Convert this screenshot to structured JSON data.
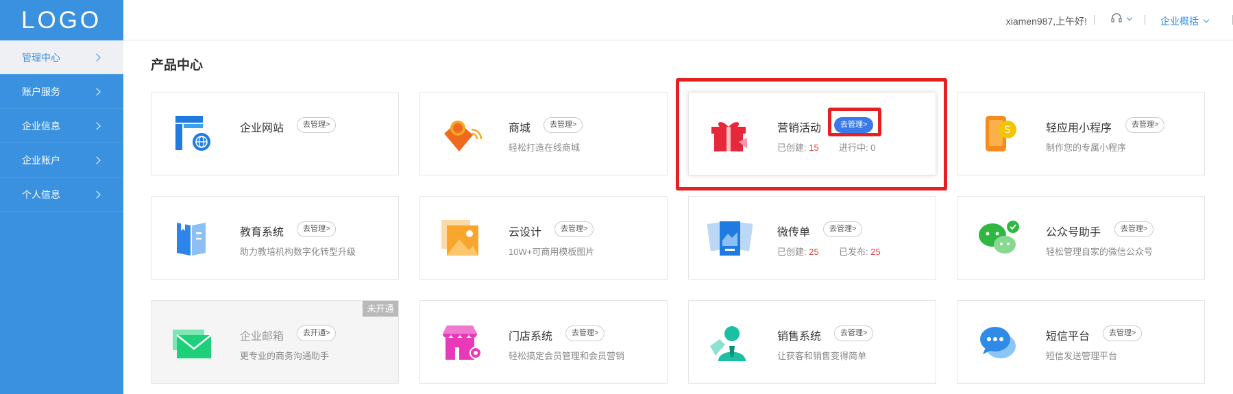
{
  "logo": "LOGO",
  "sidebar": {
    "items": [
      {
        "label": "管理中心"
      },
      {
        "label": "账户服务"
      },
      {
        "label": "企业信息"
      },
      {
        "label": "企业账户"
      },
      {
        "label": "个人信息"
      }
    ]
  },
  "header": {
    "greeting": "xiamen987,上午好!",
    "support_icon": "headset-icon",
    "overview_label": "企业概括"
  },
  "main": {
    "title": "产品中心",
    "cards": [
      {
        "title": "企业网站",
        "button": "去管理>",
        "desc": "",
        "icon": "website-icon"
      },
      {
        "title": "商城",
        "button": "去管理>",
        "desc": "轻松打造在线商城",
        "icon": "shopping-tag-icon"
      },
      {
        "title": "营销活动",
        "button": "去管理>",
        "desc_prefix1": "已创建:",
        "value1": "15",
        "desc_prefix2": "进行中:",
        "value2": "0",
        "icon": "gift-icon"
      },
      {
        "title": "轻应用小程序",
        "button": "去管理>",
        "desc": "制作您的专属小程序",
        "icon": "miniprogram-phone-icon"
      },
      {
        "title": "教育系统",
        "button": "去管理>",
        "desc": "助力教培机构数字化转型升级",
        "icon": "book-icon"
      },
      {
        "title": "云设计",
        "button": "去管理>",
        "desc": "10W+可商用模板图片",
        "icon": "image-template-icon"
      },
      {
        "title": "微传单",
        "button": "去管理>",
        "desc_prefix1": "已创建:",
        "value1": "25",
        "desc_prefix2": "已发布:",
        "value2": "25",
        "icon": "flyer-icon"
      },
      {
        "title": "公众号助手",
        "button": "去管理>",
        "desc": "轻松管理自家的微信公众号",
        "icon": "wechat-icon"
      },
      {
        "title": "企业邮箱",
        "button": "去开通>",
        "desc": "更专业的商务沟通助手",
        "badge": "未开通",
        "icon": "mail-icon"
      },
      {
        "title": "门店系统",
        "button": "去管理>",
        "desc": "轻松搞定会员管理和会员营销",
        "icon": "store-icon"
      },
      {
        "title": "销售系统",
        "button": "去管理>",
        "desc": "让获客和销售变得简单",
        "icon": "salesperson-icon"
      },
      {
        "title": "短信平台",
        "button": "去管理>",
        "desc": "短信发送管理平台",
        "icon": "chat-bubble-icon"
      }
    ]
  },
  "colors": {
    "sidebar": "#3a91df",
    "primary_button": "#3a7ae8",
    "highlight": "#e62020",
    "number_red": "#e13d3d"
  }
}
